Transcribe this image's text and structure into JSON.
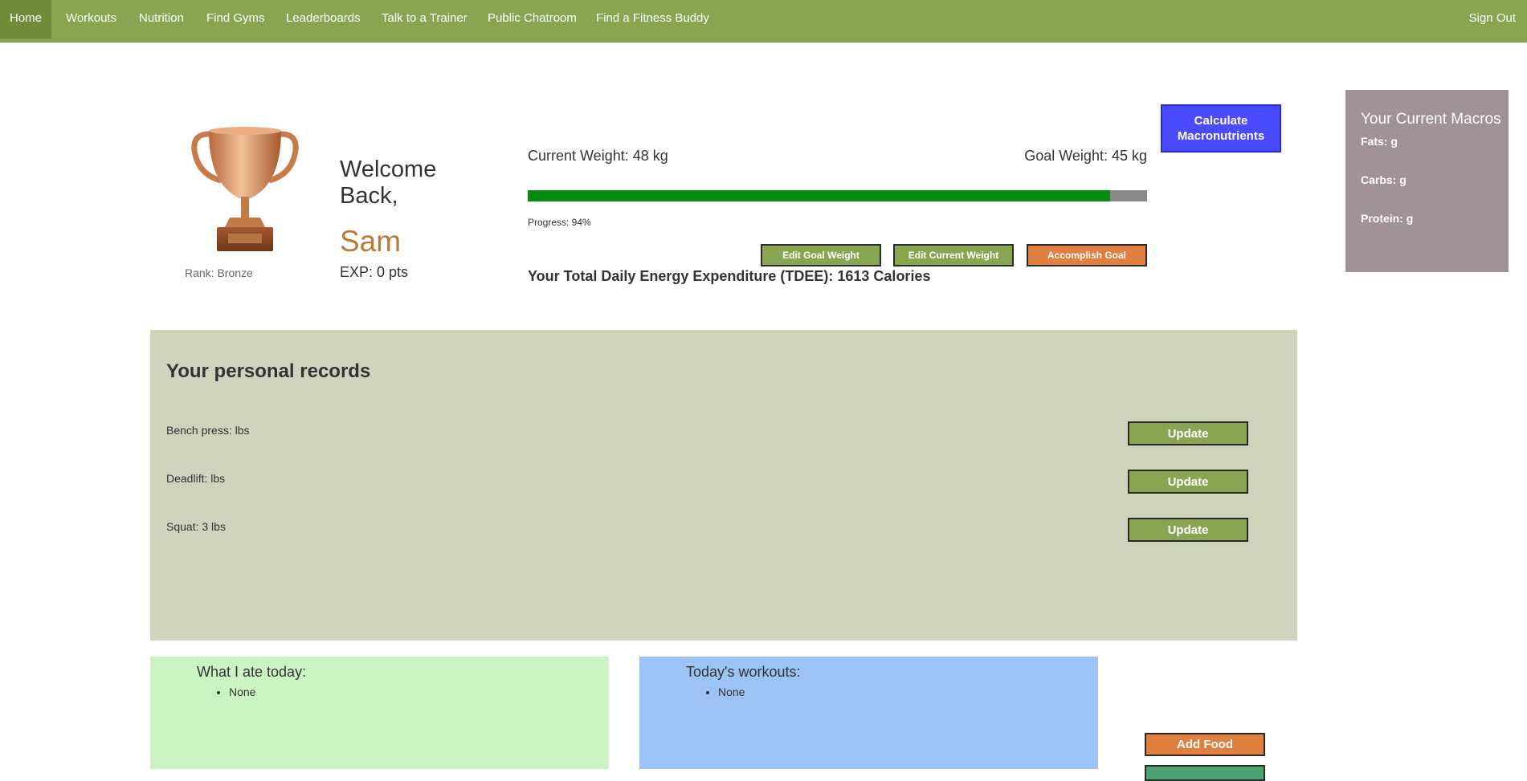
{
  "nav": {
    "items": [
      "Home",
      "Workouts",
      "Nutrition",
      "Find Gyms",
      "Leaderboards",
      "Talk to a Trainer",
      "Public Chatroom",
      "Find a Fitness Buddy"
    ],
    "signout": "Sign Out"
  },
  "profile": {
    "welcome": "Welcome Back,",
    "name": "Sam",
    "exp": "EXP: 0 pts",
    "rank": "Rank: Bronze"
  },
  "weight": {
    "current": "Current Weight: 48 kg",
    "goal": "Goal Weight: 45 kg",
    "progress_label": "Progress: 94%",
    "progress_fraction": 0.94,
    "edit_goal": "Edit Goal Weight",
    "edit_current": "Edit Current Weight",
    "accomplish": "Accomplish Goal",
    "tdee": "Your Total Daily Energy Expenditure (TDEE): 1613 Calories"
  },
  "calc_button": "Calculate Macronutrients",
  "macros": {
    "title": "Your Current Macros",
    "fats": "Fats: g",
    "carbs": "Carbs: g",
    "protein": "Protein: g"
  },
  "records": {
    "title": "Your personal records",
    "items": [
      {
        "label": "Bench press: lbs",
        "button": "Update"
      },
      {
        "label": "Deadlift: lbs",
        "button": "Update"
      },
      {
        "label": "Squat: 3 lbs",
        "button": "Update"
      }
    ]
  },
  "food": {
    "title": "What I ate today:",
    "items": [
      "None"
    ]
  },
  "workouts": {
    "title": "Today's workouts:",
    "items": [
      "None"
    ]
  },
  "add_food": "Add Food",
  "colors": {
    "nav": "#88a552",
    "accent_orange": "#e07f40",
    "progress_fill": "#078a0f",
    "calc_button": "#4a4aff"
  }
}
